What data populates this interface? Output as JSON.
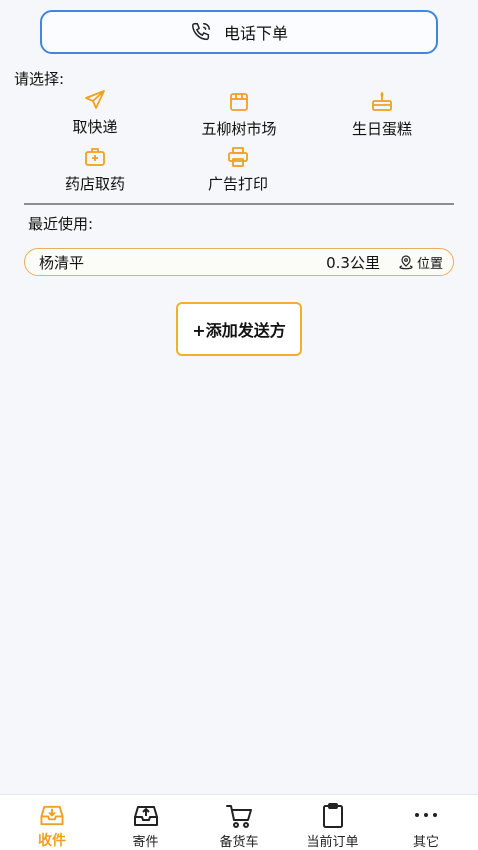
{
  "phone_order": {
    "label": "电话下单",
    "icon": "phone-icon"
  },
  "choose_label": "请选择:",
  "categories": [
    {
      "label": "取快递",
      "icon": "send-icon"
    },
    {
      "label": "五柳树市场",
      "icon": "store-icon"
    },
    {
      "label": "生日蛋糕",
      "icon": "cake-icon"
    },
    {
      "label": "药店取药",
      "icon": "medkit-icon"
    },
    {
      "label": "广告打印",
      "icon": "printer-icon"
    }
  ],
  "recent_label": "最近使用:",
  "recent": [
    {
      "name": "杨清平",
      "distance": "0.3公里",
      "location_label": "位置"
    }
  ],
  "add_sender_label": "+添加发送方",
  "tabs": [
    {
      "label": "收件",
      "icon": "inbox-icon",
      "active": true
    },
    {
      "label": "寄件",
      "icon": "outbox-icon",
      "active": false
    },
    {
      "label": "备货车",
      "icon": "cart-icon",
      "active": false
    },
    {
      "label": "当前订单",
      "icon": "clipboard-icon",
      "active": false
    },
    {
      "label": "其它",
      "icon": "more-icon",
      "active": false
    }
  ],
  "colors": {
    "accent": "#f0a020",
    "phone_border": "#3f86e0",
    "recent_border": "#e6b15a"
  }
}
